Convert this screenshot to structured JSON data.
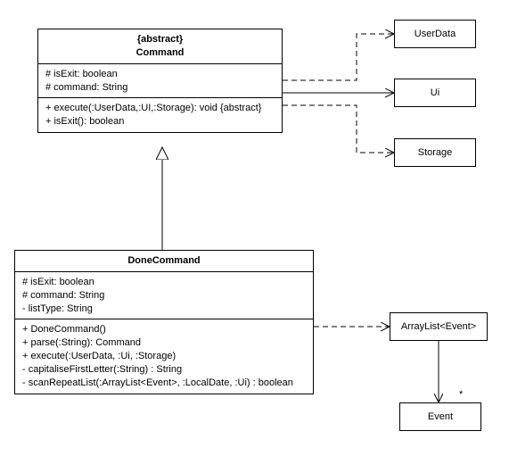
{
  "command": {
    "stereotype": "{abstract}",
    "name": "Command",
    "attrs": [
      "# isExit: boolean",
      "# command: String"
    ],
    "ops": [
      "+ execute(:UserData,:UI,:Storage): void {abstract}",
      "+ isExit(): boolean"
    ]
  },
  "done": {
    "name": "DoneCommand",
    "attrs": [
      "# isExit: boolean",
      "# command: String",
      "- listType: String"
    ],
    "ops": [
      "+ DoneCommand()",
      "+ parse(:String): Command",
      "+ execute(:UserData, :Ui, :Storage)",
      "- capitaliseFirstLetter(:String) : String",
      "- scanRepeatList(:ArrayList<Event>, :LocalDate, :Ui) : boolean"
    ]
  },
  "userdata": {
    "name": "UserData"
  },
  "ui": {
    "name": "Ui"
  },
  "storage": {
    "name": "Storage"
  },
  "arraylist": {
    "name": "ArrayList<Event>"
  },
  "event": {
    "name": "Event",
    "multiplicity": "*"
  }
}
